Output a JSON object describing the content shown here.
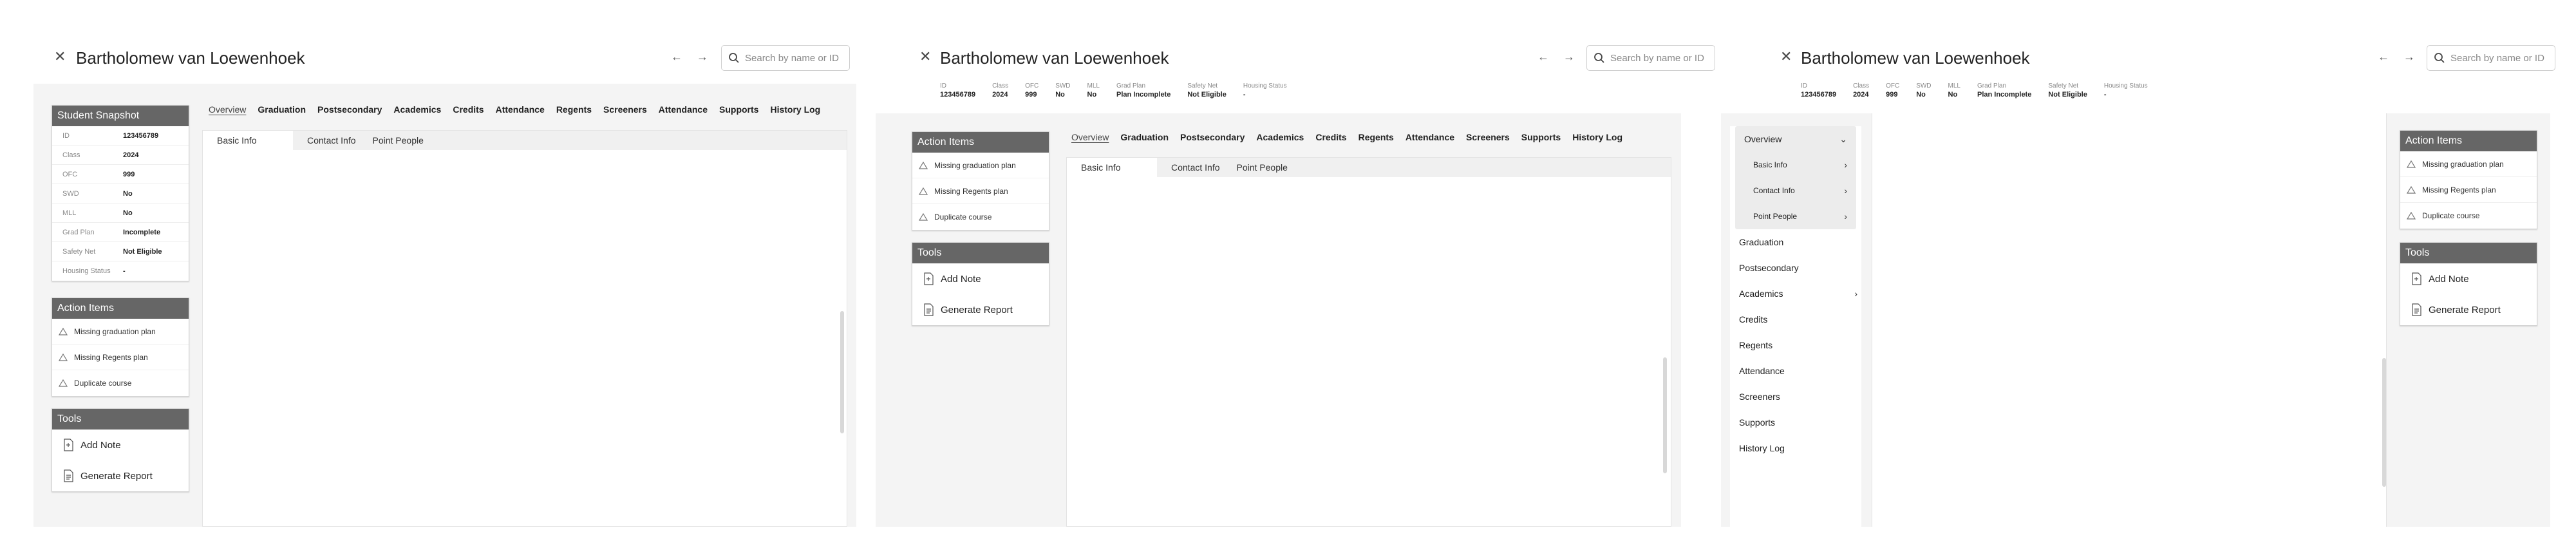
{
  "student_name": "Bartholomew van Loewenhoek",
  "search_placeholder": "Search by name or ID",
  "snapshot": {
    "title": "Student Snapshot",
    "rows": [
      {
        "label": "ID",
        "value": "123456789"
      },
      {
        "label": "Class",
        "value": "2024"
      },
      {
        "label": "OFC",
        "value": "999"
      },
      {
        "label": "SWD",
        "value": "No"
      },
      {
        "label": "MLL",
        "value": "No"
      },
      {
        "label": "Grad Plan",
        "value": "Incomplete"
      },
      {
        "label": "Safety Net",
        "value": "Not Eligible"
      },
      {
        "label": "Housing Status",
        "value": "-"
      }
    ]
  },
  "strip": [
    {
      "label": "ID",
      "value": "123456789"
    },
    {
      "label": "Class",
      "value": "2024"
    },
    {
      "label": "OFC",
      "value": "999"
    },
    {
      "label": "SWD",
      "value": "No"
    },
    {
      "label": "MLL",
      "value": "No"
    },
    {
      "label": "Grad Plan",
      "value": "Plan Incomplete"
    },
    {
      "label": "Safety Net",
      "value": "Not Eligible"
    },
    {
      "label": "Housing Status",
      "value": "-"
    }
  ],
  "action_items": {
    "title": "Action Items",
    "items": [
      "Missing graduation plan",
      "Missing Regents plan",
      "Duplicate course"
    ]
  },
  "tools": {
    "title": "Tools",
    "items": [
      "Add Note",
      "Generate Report"
    ]
  },
  "tabs": [
    "Overview",
    "Graduation",
    "Postsecondary",
    "Academics",
    "Credits",
    "Attendance",
    "Regents",
    "Screeners",
    "Attendance",
    "Supports",
    "History Log"
  ],
  "tabs2": [
    "Overview",
    "Graduation",
    "Postsecondary",
    "Academics",
    "Credits",
    "Regents",
    "Attendance",
    "Screeners",
    "Supports",
    "History Log"
  ],
  "subtabs": [
    "Basic Info",
    "Contact Info",
    "Point People"
  ],
  "sidenav": {
    "overview": "Overview",
    "sub": [
      "Basic Info",
      "Contact Info",
      "Point People"
    ],
    "items": [
      "Graduation",
      "Postsecondary",
      "Academics",
      "Credits",
      "Regents",
      "Attendance",
      "Screeners",
      "Supports",
      "History Log"
    ]
  },
  "colors": {
    "card_header": "#666666",
    "canvas": "#f4f4f4",
    "border": "#d4d4d4"
  },
  "icons": [
    "close-icon",
    "arrow-left-icon",
    "arrow-right-icon",
    "search-icon",
    "warning-icon",
    "add-note-icon",
    "report-icon",
    "chevron-right-icon",
    "chevron-down-icon"
  ]
}
